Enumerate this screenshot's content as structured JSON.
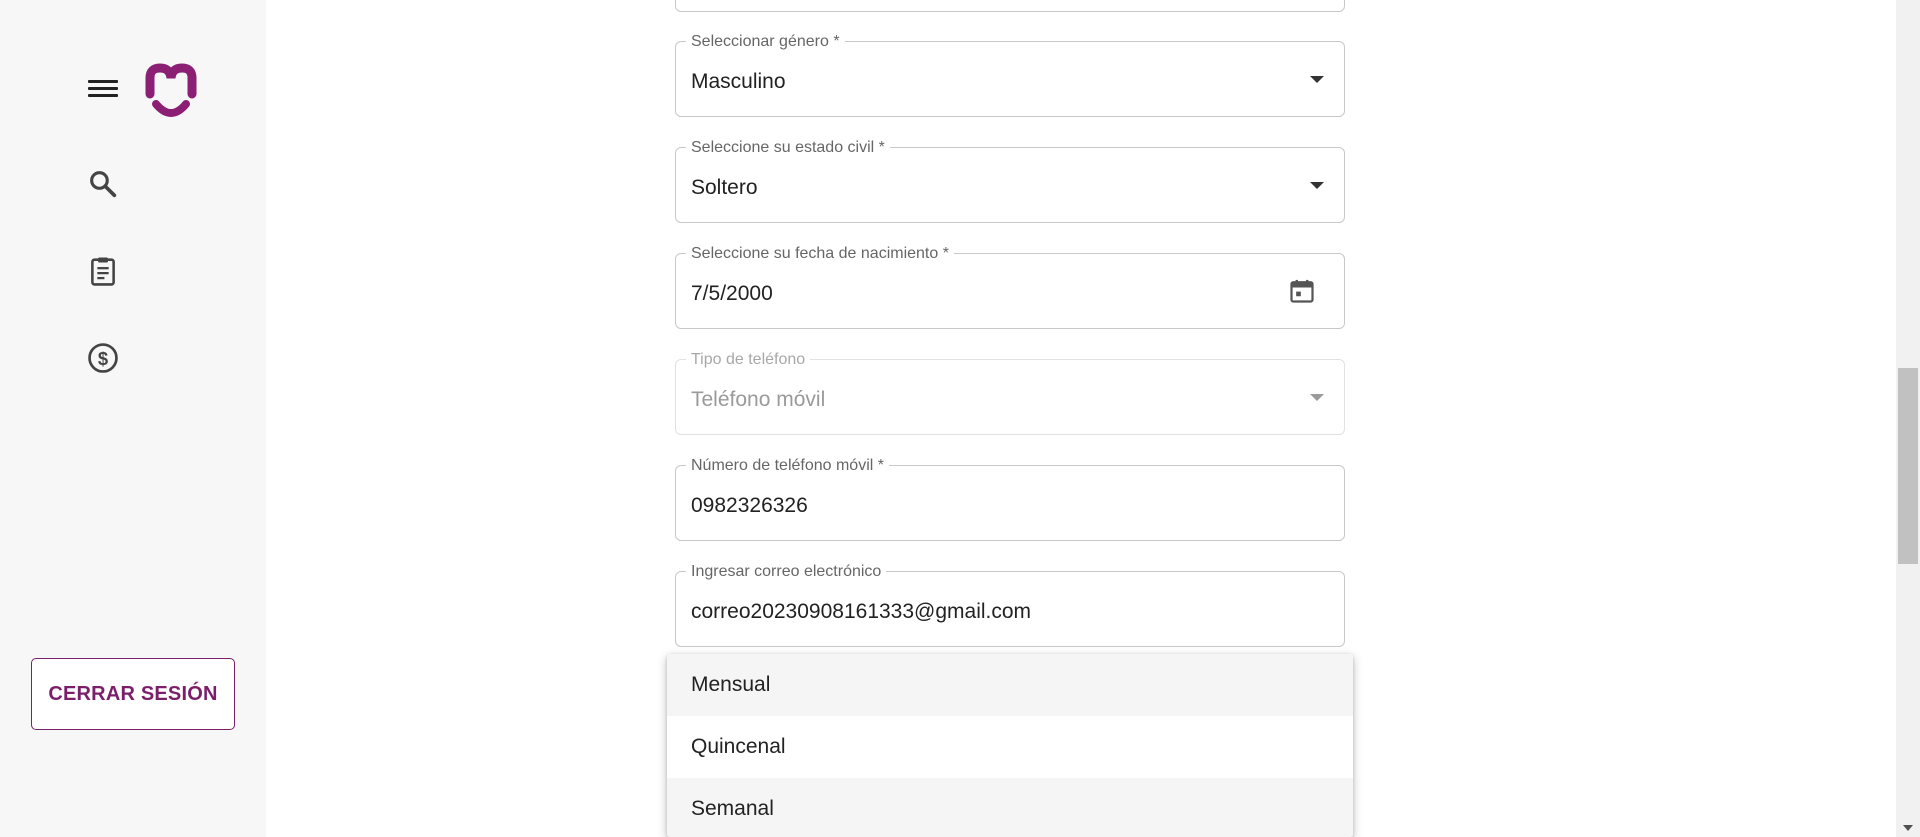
{
  "sidebar": {
    "icons": [
      "menu-icon",
      "search-icon",
      "clipboard-icon",
      "dollar-icon"
    ],
    "logout_label": "CERRAR SESIÓN"
  },
  "form": {
    "gender": {
      "label": "Seleccionar género *",
      "value": "Masculino"
    },
    "civil_status": {
      "label": "Seleccione su estado civil *",
      "value": "Soltero"
    },
    "birth_date": {
      "label": "Seleccione su fecha de nacimiento *",
      "value": "7/5/2000"
    },
    "phone_type": {
      "label": "Tipo de teléfono",
      "value": "Teléfono móvil"
    },
    "mobile_number": {
      "label": "Número de teléfono móvil *",
      "value": "0982326326"
    },
    "email": {
      "label": "Ingresar correo electrónico",
      "value": "correo20230908161333@gmail.com"
    }
  },
  "dropdown": {
    "options": [
      "Mensual",
      "Quincenal",
      "Semanal"
    ]
  },
  "colors": {
    "brand": "#8a1f74",
    "accent_border": "#7b1f6b",
    "sidebar_bg": "#f7f7f7"
  }
}
